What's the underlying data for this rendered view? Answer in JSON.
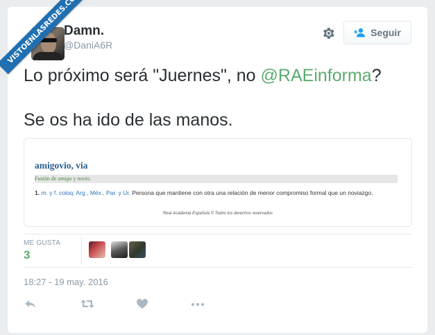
{
  "watermark": "VISTOENLASREDES.COM",
  "author": {
    "name": "Damn.",
    "handle": "@DaniA6R"
  },
  "follow_button": {
    "label": "Seguir"
  },
  "tweet": {
    "line1_before": "Lo próximo será \"Juernes\", no ",
    "mention": "@RAEinforma",
    "line1_after": "?",
    "line2": "Se os ha ido de las manos."
  },
  "media": {
    "word": "amigovio, via",
    "fusion_prefix": "Fusión de ",
    "fusion_word1": "amigo",
    "fusion_mid": " y ",
    "fusion_word2": "novio",
    "fusion_suffix": ".",
    "def_number": "1.",
    "def_abbrs": "m. y f. coloq. Arg., Méx., Par. y Ur.",
    "def_text": "Persona que mantiene con otra una relación de menor compromiso formal que un noviazgo.",
    "copyright": "Real Academia Española © Todos los derechos reservados"
  },
  "stats": {
    "likes_label": "ME GUSTA",
    "likes_count": "3"
  },
  "timestamp": "18:27 - 19 may. 2016",
  "icons": [
    "settings-gear-icon",
    "follow-user-icon",
    "reply-icon",
    "retweet-icon",
    "like-heart-icon",
    "more-icon"
  ],
  "colors": {
    "mention": "#5bab6e",
    "likes": "#5bab6e",
    "ribbon": "#1f6fb1",
    "muted": "#8899a6"
  }
}
